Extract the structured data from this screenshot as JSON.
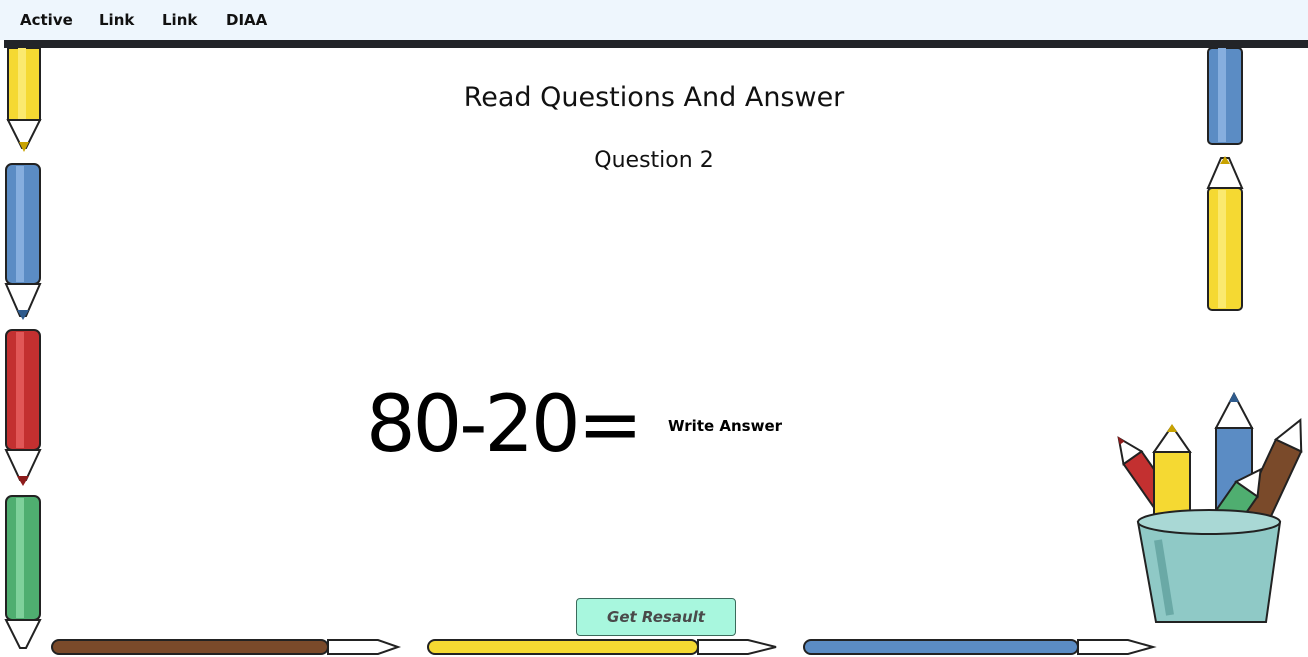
{
  "nav": {
    "items": [
      {
        "label": "Active"
      },
      {
        "label": "Link"
      },
      {
        "label": "Link"
      },
      {
        "label": "DIAA"
      }
    ]
  },
  "main": {
    "title": "Read Questions And Answer",
    "question_label": "Question 2",
    "equation": "80-20=",
    "answer_placeholder": "Write Answer",
    "submit_label": "Get Resault"
  },
  "decorations": {
    "pencil_colors": {
      "yellow": "#f5d932",
      "blue": "#5b8cc4",
      "red": "#c33030",
      "green": "#4fae70",
      "brown": "#7a4a2a",
      "cup": "#8fc9c6"
    },
    "icons": [
      "pencil-icon",
      "pencil-cup-icon"
    ]
  },
  "colors": {
    "nav_background": "#eef6fd",
    "nav_underline": "#222428",
    "button_background": "#a8f7de"
  }
}
